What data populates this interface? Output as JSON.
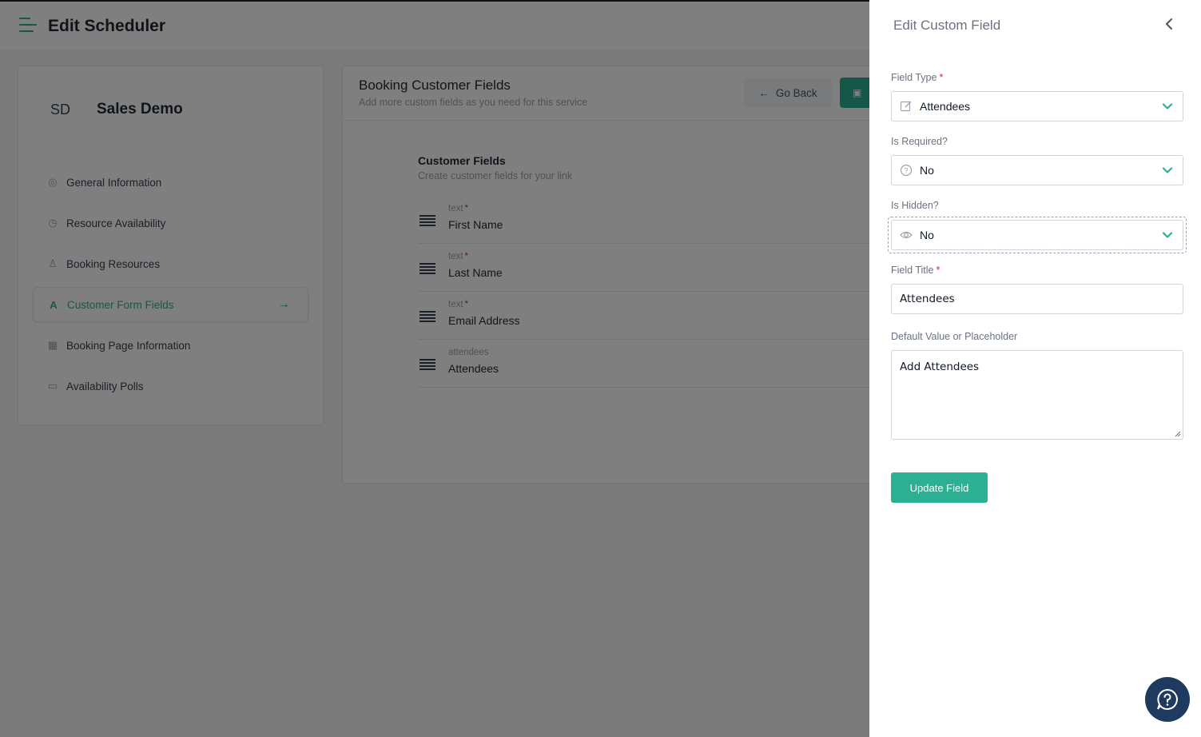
{
  "header": {
    "title": "Edit Scheduler"
  },
  "sidebar": {
    "initials": "SD",
    "name": "Sales Demo",
    "items": [
      {
        "label": "General Information",
        "icon": "globe-icon"
      },
      {
        "label": "Resource Availability",
        "icon": "clock-icon"
      },
      {
        "label": "Booking Resources",
        "icon": "user-icon"
      },
      {
        "label": "Customer Form Fields",
        "icon": "text-field-icon",
        "active": true
      },
      {
        "label": "Booking Page Information",
        "icon": "calendar-icon"
      },
      {
        "label": "Availability Polls",
        "icon": "card-icon"
      }
    ]
  },
  "main": {
    "title": "Booking Customer Fields",
    "subtitle": "Add more custom fields as you need for this service",
    "go_back": "Go Back",
    "customer_fields_title": "Customer Fields",
    "customer_fields_subtitle": "Create customer fields for your link",
    "fields": [
      {
        "type": "text",
        "required": true,
        "name": "First Name"
      },
      {
        "type": "text",
        "required": true,
        "name": "Last Name"
      },
      {
        "type": "text",
        "required": true,
        "name": "Email Address"
      },
      {
        "type": "attendees",
        "required": false,
        "name": "Attendees"
      }
    ]
  },
  "panel": {
    "title": "Edit Custom Field",
    "field_type_label": "Field Type",
    "field_type_value": "Attendees",
    "is_required_label": "Is Required?",
    "is_required_value": "No",
    "is_hidden_label": "Is Hidden?",
    "is_hidden_value": "No",
    "field_title_label": "Field Title",
    "field_title_value": "Attendees",
    "default_value_label": "Default Value or Placeholder",
    "default_value_value": "Add Attendees",
    "update_button": "Update Field",
    "required_marker": "*"
  },
  "colors": {
    "accent": "#2bb093",
    "required": "#dc2626",
    "help_button": "#1e3a5f"
  }
}
